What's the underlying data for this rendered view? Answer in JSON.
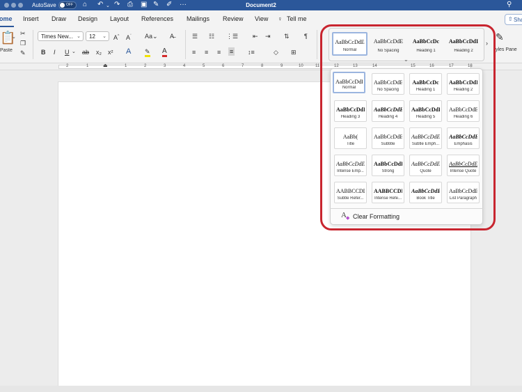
{
  "window": {
    "title": "Document2",
    "autosave_label": "AutoSave",
    "autosave_state": "OFF"
  },
  "tabs": [
    "ome",
    "Insert",
    "Draw",
    "Design",
    "Layout",
    "References",
    "Mailings",
    "Review",
    "View",
    "Tell me"
  ],
  "share_label": "Sha",
  "ribbon": {
    "font_name": "Times New...",
    "font_size": "12",
    "paste_label": "Paste",
    "styles_pane_label": "tyles Pane"
  },
  "ruler_numbers": [
    "2",
    "1",
    "1",
    "2",
    "3",
    "4",
    "5",
    "6",
    "7",
    "8",
    "9",
    "10",
    "11",
    "12",
    "13",
    "14",
    "15",
    "16",
    "17",
    "18"
  ],
  "gallery_strip": [
    {
      "preview": "AaBbCcDdE",
      "label": "Normal",
      "style": "normal",
      "selected": true
    },
    {
      "preview": "AaBbCcDdE",
      "label": "No Spacing",
      "style": "normal",
      "selected": false
    },
    {
      "preview": "AaBbCcDc",
      "label": "Heading 1",
      "style": "heading1",
      "selected": false
    },
    {
      "preview": "AaBbCcDdI",
      "label": "Heading 2",
      "style": "heading2",
      "selected": false
    }
  ],
  "styles": [
    {
      "preview": "AaBbCcDdE",
      "label": "Normal",
      "style": "normal",
      "selected": true
    },
    {
      "preview": "AaBbCcDdE",
      "label": "No Spacing",
      "style": "normal",
      "selected": false
    },
    {
      "preview": "AaBbCcDc",
      "label": "Heading 1",
      "style": "heading1",
      "selected": false
    },
    {
      "preview": "AaBbCcDdI",
      "label": "Heading 2",
      "style": "heading2",
      "selected": false
    },
    {
      "preview": "AaBbCcDdI",
      "label": "Heading 3",
      "style": "heading3",
      "selected": false
    },
    {
      "preview": "AaBbCcDdE",
      "label": "Heading 4",
      "style": "heading4",
      "selected": false
    },
    {
      "preview": "AaBbCcDdEe",
      "label": "Heading 5",
      "style": "heading5",
      "selected": false
    },
    {
      "preview": "AaBbCcDdEe",
      "label": "Heading 6",
      "style": "heading6",
      "selected": false
    },
    {
      "preview": "AaBb(",
      "label": "Title",
      "style": "title",
      "selected": false
    },
    {
      "preview": "AaBbCcDdEe",
      "label": "Subtitle",
      "style": "subtitle",
      "selected": false
    },
    {
      "preview": "AaBbCcDdEe",
      "label": "Subtle Emph...",
      "style": "subtle-emph",
      "selected": false
    },
    {
      "preview": "AaBbCcDdEe",
      "label": "Emphasis",
      "style": "emphasis",
      "selected": false
    },
    {
      "preview": "AaBbCcDdEe",
      "label": "Intense Emp...",
      "style": "intense-emph",
      "selected": false
    },
    {
      "preview": "AaBbCcDdEe",
      "label": "Strong",
      "style": "strong",
      "selected": false
    },
    {
      "preview": "AaBbCcDdEe",
      "label": "Quote",
      "style": "quote",
      "selected": false
    },
    {
      "preview": "AaBbCcDdEe",
      "label": "Intense Quote",
      "style": "intense-quote",
      "selected": false
    },
    {
      "preview": "AABBCCDDEE",
      "label": "Subtle Refer...",
      "style": "subtle-ref",
      "selected": false
    },
    {
      "preview": "AABBCCDDEE",
      "label": "Intense Refe...",
      "style": "intense-ref",
      "selected": false
    },
    {
      "preview": "AaBbCcDdEe",
      "label": "Book Title",
      "style": "book-title",
      "selected": false
    },
    {
      "preview": "AaBbCcDdE",
      "label": "List Paragraph",
      "style": "list-para",
      "selected": false
    }
  ],
  "clear_formatting_label": "Clear Formatting",
  "colors": {
    "brand": "#2b579a",
    "highlight_ring": "#c8252f",
    "selected_tile_border": "#9bb5df"
  }
}
